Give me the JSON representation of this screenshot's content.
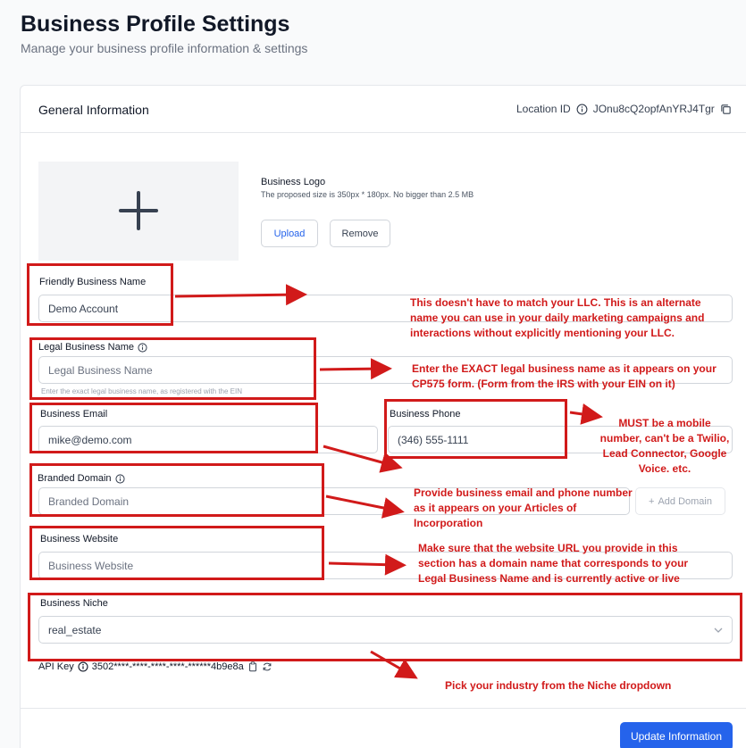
{
  "header": {
    "title": "Business Profile Settings",
    "subtitle": "Manage your business profile information & settings"
  },
  "card": {
    "title": "General Information",
    "location_label": "Location ID",
    "location_value": "JOnu8cQ2opfAnYRJ4Tgr"
  },
  "logo": {
    "label": "Business Logo",
    "hint": "The proposed size is 350px * 180px. No bigger than 2.5 MB",
    "upload_label": "Upload",
    "remove_label": "Remove"
  },
  "fields": {
    "friendly_name": {
      "label": "Friendly Business Name",
      "value": "Demo Account"
    },
    "legal_name": {
      "label": "Legal Business Name",
      "placeholder": "Legal Business Name",
      "hint": "Enter the exact legal business name, as registered with the EIN"
    },
    "email": {
      "label": "Business Email",
      "value": "mike@demo.com"
    },
    "phone": {
      "label": "Business Phone",
      "value": "(346) 555-1111"
    },
    "domain": {
      "label": "Branded Domain",
      "placeholder": "Branded Domain",
      "add_label": "Add Domain"
    },
    "website": {
      "label": "Business Website",
      "placeholder": "Business Website"
    },
    "niche": {
      "label": "Business Niche",
      "value": "real_estate"
    }
  },
  "api": {
    "label": "API Key",
    "value": "3502****-****-****-****-******4b9e8a"
  },
  "footer": {
    "update_label": "Update Information"
  },
  "annotations": {
    "friendly": "This doesn't have to match your LLC. This is an alternate name you can use in your daily marketing campaigns and interactions without explicitly mentioning your LLC.",
    "legal": "Enter the EXACT legal business name as it appears on your CP575 form. (Form from the IRS with your EIN on it)",
    "phone": "MUST be a mobile number, can't be a Twilio, Lead Connector, Google Voice. etc.",
    "email_phone": "Provide business email and phone number as it appears on your Articles of Incorporation",
    "website": "Make sure that the website URL you provide in this section has a domain name that corresponds to your Legal Business Name and is currently active or live",
    "niche": "Pick your industry from the Niche dropdown"
  },
  "colors": {
    "accent": "#2563eb",
    "annotation_red": "#d11a1a"
  }
}
